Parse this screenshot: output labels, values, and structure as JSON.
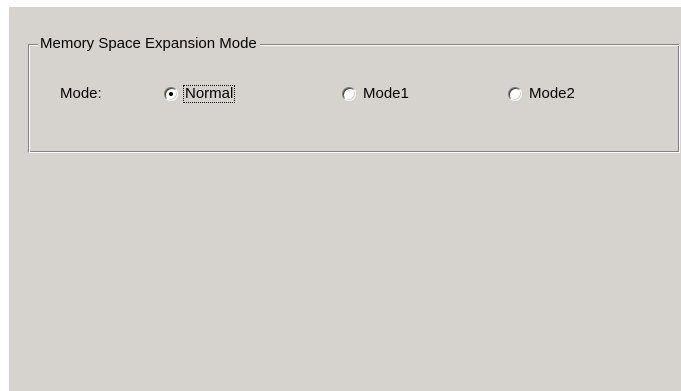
{
  "dialog": {
    "group": {
      "title": "Memory Space Expansion Mode",
      "mode_label": "Mode:",
      "options": [
        {
          "label": "Normal",
          "selected": true,
          "focused": true
        },
        {
          "label": "Mode1",
          "selected": false,
          "focused": false
        },
        {
          "label": "Mode2",
          "selected": false,
          "focused": false
        }
      ]
    }
  }
}
